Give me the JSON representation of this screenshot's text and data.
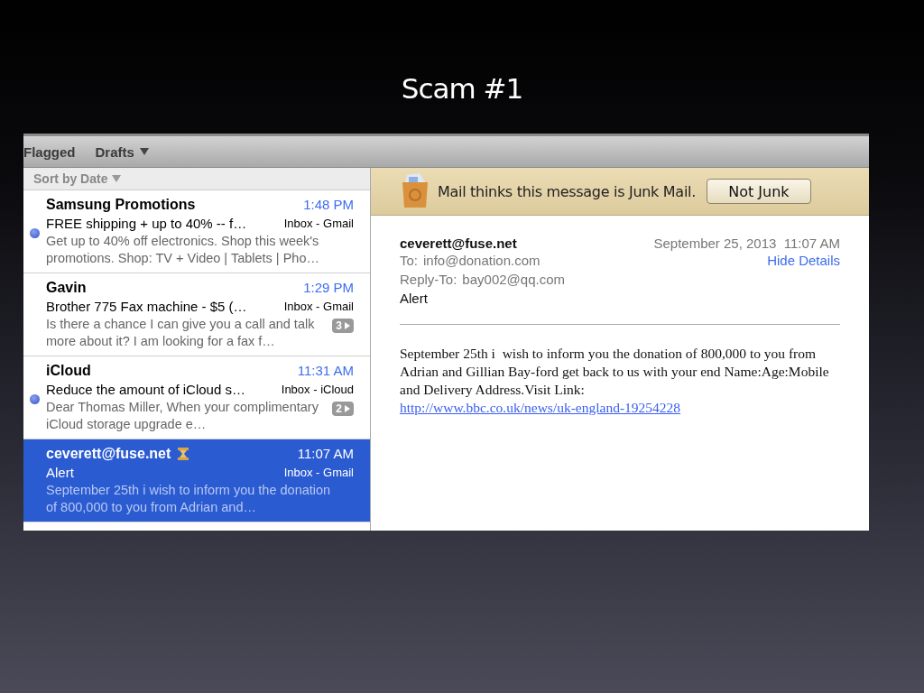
{
  "slide": {
    "title": "Scam #1"
  },
  "toolbar": {
    "items": [
      {
        "label": "Flagged",
        "dropdown": false
      },
      {
        "label": "Drafts",
        "dropdown": true
      }
    ]
  },
  "sort": {
    "label": "Sort by Date"
  },
  "messages": [
    {
      "sender": "Samsung Promotions",
      "time": "1:48 PM",
      "subject": "FREE shipping + up to 40% -- f…",
      "mailbox": "Inbox - Gmail",
      "preview": "Get up to 40% off electronics. Shop this week's promotions. Shop: TV + Video | Tablets | Pho…",
      "unread": true,
      "junk": false,
      "selected": false
    },
    {
      "sender": "Gavin",
      "time": "1:29 PM",
      "subject": "Brother 775 Fax machine - $5 (…",
      "mailbox": "Inbox - Gmail",
      "preview": "Is there a chance I can give you a call and talk more about it? I am looking for a fax f…",
      "thread_count": "3",
      "unread": false,
      "junk": false,
      "selected": false
    },
    {
      "sender": "iCloud",
      "time": "11:31 AM",
      "subject": "Reduce the amount of iCloud s…",
      "mailbox": "Inbox - iCloud",
      "preview": "Dear Thomas Miller, When your complimentary iCloud storage upgrade e…",
      "thread_count": "2",
      "unread": true,
      "junk": false,
      "selected": false
    },
    {
      "sender": "ceverett@fuse.net",
      "time": "11:07 AM",
      "subject": "Alert",
      "mailbox": "Inbox - Gmail",
      "preview": "September 25th i wish to inform you the donation of 800,000 to you from Adrian and…",
      "unread": false,
      "junk": true,
      "selected": true
    }
  ],
  "banner": {
    "text": "Mail thinks this message is Junk Mail.",
    "button": "Not Junk"
  },
  "message": {
    "from": "ceverett@fuse.net",
    "date": "September 25, 2013  11:07 AM",
    "details_link": "Hide Details",
    "to_label": "To:",
    "to": "info@donation.com",
    "reply_to_label": "Reply-To:",
    "reply_to": "bay002@qq.com",
    "subject": "Alert",
    "body": "September 25th i  wish to inform you the donation of 800,000 to you from Adrian and Gillian Bay-ford get back to us with your end Name:Age:Mobile and Delivery Address.Visit Link: ",
    "link": "http://www.bbc.co.uk/news/uk-england-19254228"
  }
}
